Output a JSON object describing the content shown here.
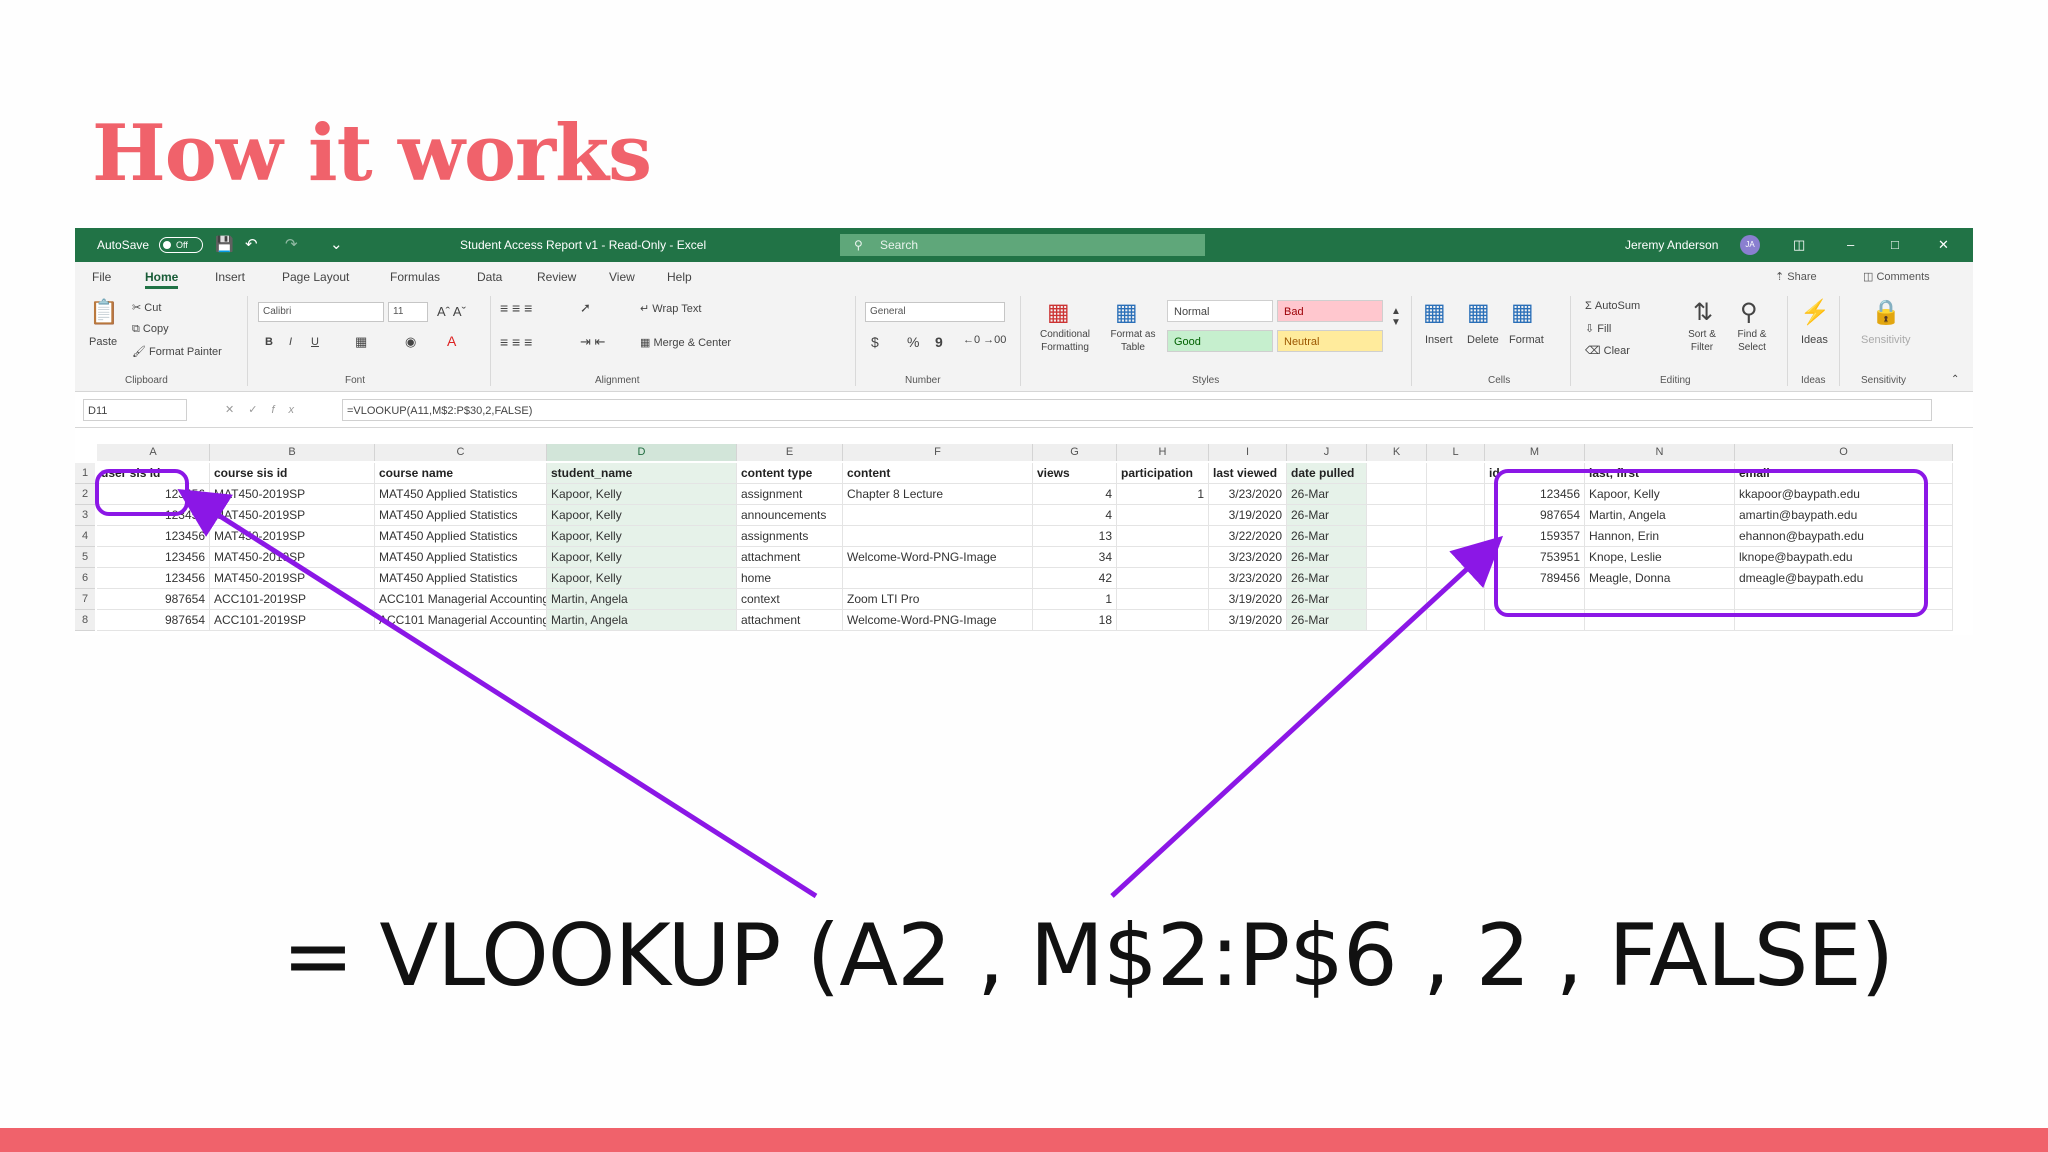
{
  "slide": {
    "title": "How it works",
    "formula": "= VLOOKUP (A2 , M$2:P$6 , 2 , FALSE)",
    "accent_color": "#f0626b",
    "highlight_color": "#8b17e6"
  },
  "excel": {
    "titlebar": {
      "autosave_label": "AutoSave",
      "autosave_state": "Off",
      "save_icon": "save-icon",
      "undo_icon": "undo-icon",
      "redo_icon": "redo-icon",
      "doc_title": "Student Access Report v1 - Read-Only - Excel",
      "search_placeholder": "Search",
      "user_name": "Jeremy Anderson",
      "user_initials": "JA"
    },
    "menu": {
      "tabs": [
        "File",
        "Home",
        "Insert",
        "Page Layout",
        "Formulas",
        "Data",
        "Review",
        "View",
        "Help"
      ],
      "active_tab": "Home",
      "share": "Share",
      "comments": "Comments"
    },
    "ribbon": {
      "clipboard": {
        "paste": "Paste",
        "cut": "Cut",
        "copy": "Copy",
        "format_painter": "Format Painter",
        "label": "Clipboard"
      },
      "font": {
        "name": "Calibri",
        "size": "11",
        "bold": "B",
        "italic": "I",
        "underline": "U",
        "label": "Font"
      },
      "alignment": {
        "wrap_text": "Wrap Text",
        "merge_center": "Merge & Center",
        "label": "Alignment"
      },
      "number": {
        "format": "General",
        "currency": "$",
        "percent": "%",
        "comma": "9",
        "label": "Number"
      },
      "styles": {
        "conditional_formatting": "Conditional Formatting",
        "format_as_table": "Format as Table",
        "normal": "Normal",
        "bad": "Bad",
        "good": "Good",
        "neutral": "Neutral",
        "label": "Styles"
      },
      "cells": {
        "insert": "Insert",
        "delete": "Delete",
        "format": "Format",
        "label": "Cells"
      },
      "editing": {
        "autosum": "AutoSum",
        "fill": "Fill",
        "clear": "Clear",
        "sort_filter": "Sort & Filter",
        "find_select": "Find & Select",
        "label": "Editing"
      },
      "ideas": {
        "button": "Ideas",
        "label": "Ideas"
      },
      "sensitivity": {
        "button": "Sensitivity",
        "label": "Sensitivity"
      }
    },
    "formula_bar": {
      "name_box": "D11",
      "formula": "=VLOOKUP(A11,M$2:P$30,2,FALSE)"
    },
    "columns": [
      "A",
      "B",
      "C",
      "D",
      "E",
      "F",
      "G",
      "H",
      "I",
      "J",
      "K",
      "L",
      "M",
      "N",
      "O"
    ],
    "rows": [
      {
        "n": "1",
        "a": "user sis id",
        "b": "course sis id",
        "c": "course name",
        "d": "student_name",
        "e": "content type",
        "f": "content",
        "g": "views",
        "h": "participation",
        "i": "last viewed",
        "j": "date pulled",
        "m": "id",
        "nn": "last, first",
        "o": "email"
      },
      {
        "n": "2",
        "a": "123456",
        "b": "MAT450-2019SP",
        "c": "MAT450 Applied Statistics",
        "d": "Kapoor, Kelly",
        "e": "assignment",
        "f": "Chapter 8 Lecture",
        "g": "4",
        "h": "1",
        "i": "3/23/2020",
        "j": "26-Mar",
        "m": "123456",
        "nn": "Kapoor, Kelly",
        "o": "kkapoor@baypath.edu"
      },
      {
        "n": "3",
        "a": "123456",
        "b": "MAT450-2019SP",
        "c": "MAT450 Applied Statistics",
        "d": "Kapoor, Kelly",
        "e": "announcements",
        "f": "",
        "g": "4",
        "h": "",
        "i": "3/19/2020",
        "j": "26-Mar",
        "m": "987654",
        "nn": "Martin, Angela",
        "o": "amartin@baypath.edu"
      },
      {
        "n": "4",
        "a": "123456",
        "b": "MAT450-2019SP",
        "c": "MAT450 Applied Statistics",
        "d": "Kapoor, Kelly",
        "e": "assignments",
        "f": "",
        "g": "13",
        "h": "",
        "i": "3/22/2020",
        "j": "26-Mar",
        "m": "159357",
        "nn": "Hannon, Erin",
        "o": "ehannon@baypath.edu"
      },
      {
        "n": "5",
        "a": "123456",
        "b": "MAT450-2019SP",
        "c": "MAT450 Applied Statistics",
        "d": "Kapoor, Kelly",
        "e": "attachment",
        "f": "Welcome-Word-PNG-Image",
        "g": "34",
        "h": "",
        "i": "3/23/2020",
        "j": "26-Mar",
        "m": "753951",
        "nn": "Knope, Leslie",
        "o": "lknope@baypath.edu"
      },
      {
        "n": "6",
        "a": "123456",
        "b": "MAT450-2019SP",
        "c": "MAT450 Applied Statistics",
        "d": "Kapoor, Kelly",
        "e": "home",
        "f": "",
        "g": "42",
        "h": "",
        "i": "3/23/2020",
        "j": "26-Mar",
        "m": "789456",
        "nn": "Meagle, Donna",
        "o": "dmeagle@baypath.edu"
      },
      {
        "n": "7",
        "a": "987654",
        "b": "ACC101-2019SP",
        "c": "ACC101 Managerial Accounting",
        "d": "Martin, Angela",
        "e": "context",
        "f": "Zoom LTI Pro",
        "g": "1",
        "h": "",
        "i": "3/19/2020",
        "j": "26-Mar",
        "m": "",
        "nn": "",
        "o": ""
      },
      {
        "n": "8",
        "a": "987654",
        "b": "ACC101-2019SP",
        "c": "ACC101 Managerial Accounting",
        "d": "Martin, Angela",
        "e": "attachment",
        "f": "Welcome-Word-PNG-Image",
        "g": "18",
        "h": "",
        "i": "3/19/2020",
        "j": "26-Mar",
        "m": "",
        "nn": "",
        "o": ""
      }
    ]
  }
}
